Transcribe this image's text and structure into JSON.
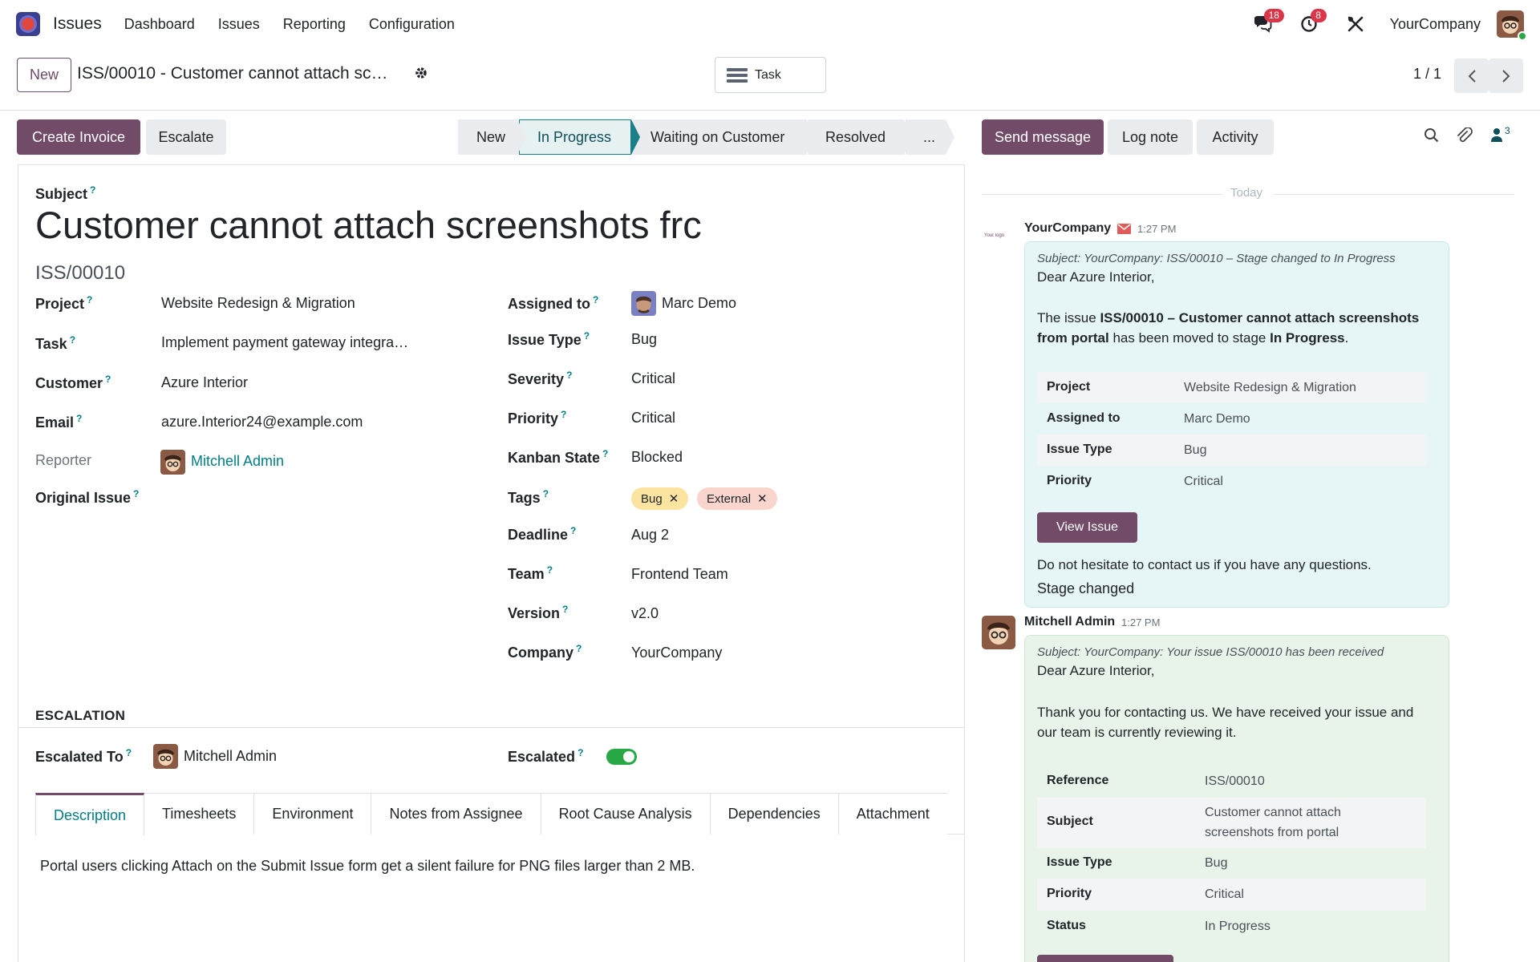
{
  "navbar": {
    "app_name": "Issues",
    "menu": [
      "Dashboard",
      "Issues",
      "Reporting",
      "Configuration"
    ],
    "messages_count": "18",
    "activities_count": "8",
    "company": "YourCompany",
    "accent": "#714b67"
  },
  "control": {
    "new_label": "New",
    "record_title": "ISS/00010 - Customer cannot attach sc…",
    "smart_button_label": "Task",
    "pager": "1 / 1"
  },
  "actions": {
    "create_invoice": "Create Invoice",
    "escalate": "Escalate"
  },
  "stages": [
    "New",
    "In Progress",
    "Waiting on Customer",
    "Resolved",
    "..."
  ],
  "active_stage": "In Progress",
  "form": {
    "subject_label": "Subject",
    "title": "Customer cannot attach screenshots frc",
    "reference": "ISS/00010",
    "left_fields": [
      {
        "label": "Project",
        "value": "Website Redesign & Migration"
      },
      {
        "label": "Task",
        "value": "Implement payment gateway integra…"
      },
      {
        "label": "Customer",
        "value": "Azure Interior"
      },
      {
        "label": "Email",
        "value": "azure.Interior24@example.com"
      },
      {
        "label": "Reporter",
        "value": "Mitchell Admin"
      },
      {
        "label": "Original Issue",
        "value": ""
      }
    ],
    "right_fields": [
      {
        "label": "Assigned to",
        "value": "Marc Demo"
      },
      {
        "label": "Issue Type",
        "value": "Bug"
      },
      {
        "label": "Severity",
        "value": "Critical"
      },
      {
        "label": "Priority",
        "value": "Critical"
      },
      {
        "label": "Kanban State",
        "value": "Blocked"
      },
      {
        "label": "Tags",
        "value": ""
      },
      {
        "label": "Deadline",
        "value": "Aug 2"
      },
      {
        "label": "Team",
        "value": "Frontend Team"
      },
      {
        "label": "Version",
        "value": "v2.0"
      },
      {
        "label": "Company",
        "value": "YourCompany"
      }
    ],
    "tags": [
      {
        "label": "Bug",
        "color": "#fbe4a0"
      },
      {
        "label": "External",
        "color": "#f9d5cd"
      }
    ],
    "escalation_title": "ESCALATION",
    "escalated_to_label": "Escalated To",
    "escalated_to_value": "Mitchell Admin",
    "escalated_label": "Escalated",
    "escalated": true,
    "tabs": [
      "Description",
      "Timesheets",
      "Environment",
      "Notes from Assignee",
      "Root Cause Analysis",
      "Dependencies",
      "Attachment"
    ],
    "active_tab": "Description",
    "description": "Portal users clicking Attach on the Submit Issue form get a silent failure for PNG files larger than 2 MB."
  },
  "chatter": {
    "send_message": "Send message",
    "log_note": "Log note",
    "activity": "Activity",
    "followers_count": "3",
    "today_label": "Today",
    "messages": [
      {
        "author": "YourCompany",
        "time": "1:27 PM",
        "logo_text": "Your logo",
        "subject": "Subject: YourCompany: ISS/00010 – Stage changed to In Progress",
        "greeting": "Dear Azure Interior,",
        "body_1": "The issue ",
        "body_bold_1": "ISS/00010 – Customer cannot attach screenshots",
        "body_bold_2": "from portal",
        "body_2": " has been moved to stage ",
        "body_bold_3": "In Progress",
        "body_3": ".",
        "table": [
          {
            "key": "Project",
            "value": "Website Redesign & Migration"
          },
          {
            "key": "Assigned to",
            "value": "Marc Demo"
          },
          {
            "key": "Issue Type",
            "value": "Bug"
          },
          {
            "key": "Priority",
            "value": "Critical"
          }
        ],
        "button": "View Issue",
        "footer": "Do not hesitate to contact us if you have any questions.",
        "tracking": "Stage changed"
      },
      {
        "author": "Mitchell Admin",
        "time": "1:27 PM",
        "subject": "Subject: YourCompany: Your issue ISS/00010 has been received",
        "greeting": "Dear Azure Interior,",
        "body_line_1": "Thank you for contacting us. We have received your issue and",
        "body_line_2": "our team is currently reviewing it.",
        "table": [
          {
            "key": "Reference",
            "value": "ISS/00010"
          },
          {
            "key": "Subject",
            "value": "Customer cannot attach",
            "value_2": "screenshots from portal"
          },
          {
            "key": "Issue Type",
            "value": "Bug"
          },
          {
            "key": "Priority",
            "value": "Critical"
          },
          {
            "key": "Status",
            "value": "In Progress"
          }
        ]
      }
    ]
  }
}
